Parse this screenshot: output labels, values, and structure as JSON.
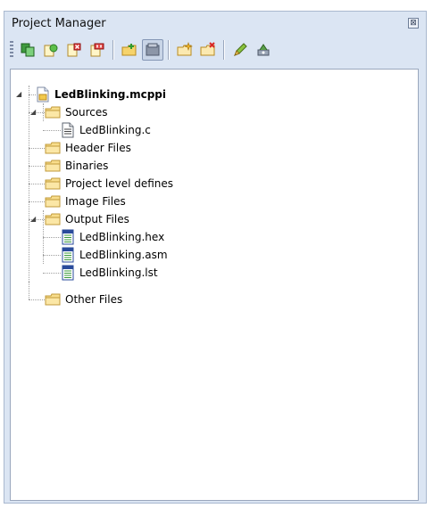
{
  "panel": {
    "title": "Project Manager",
    "close_glyph": "⊠"
  },
  "toolbar": {
    "buttons": [
      {
        "icon": "copy-icon"
      },
      {
        "icon": "build-icon"
      },
      {
        "icon": "remove-icon"
      },
      {
        "icon": "remove-all-icon"
      },
      {
        "icon": "add-folder-icon"
      },
      {
        "icon": "open-file-icon",
        "pressed": true
      },
      {
        "icon": "add-file-icon"
      },
      {
        "icon": "remove-file-icon"
      },
      {
        "icon": "edit-icon"
      },
      {
        "icon": "settings-icon"
      }
    ]
  },
  "tree": {
    "root": {
      "label": "LedBlinking.mcppi",
      "expanded": true
    },
    "items": [
      {
        "label": "Sources",
        "type": "folder",
        "expanded": true
      },
      {
        "label": "LedBlinking.c",
        "type": "file"
      },
      {
        "label": "Header Files",
        "type": "folder"
      },
      {
        "label": "Binaries",
        "type": "folder"
      },
      {
        "label": "Project level defines",
        "type": "folder"
      },
      {
        "label": "Image Files",
        "type": "folder"
      },
      {
        "label": "Output Files",
        "type": "folder",
        "expanded": true
      },
      {
        "label": "LedBlinking.hex",
        "type": "output-file"
      },
      {
        "label": "LedBlinking.asm",
        "type": "output-file"
      },
      {
        "label": "LedBlinking.lst",
        "type": "output-file"
      },
      {
        "label": "Other Files",
        "type": "folder"
      }
    ]
  }
}
